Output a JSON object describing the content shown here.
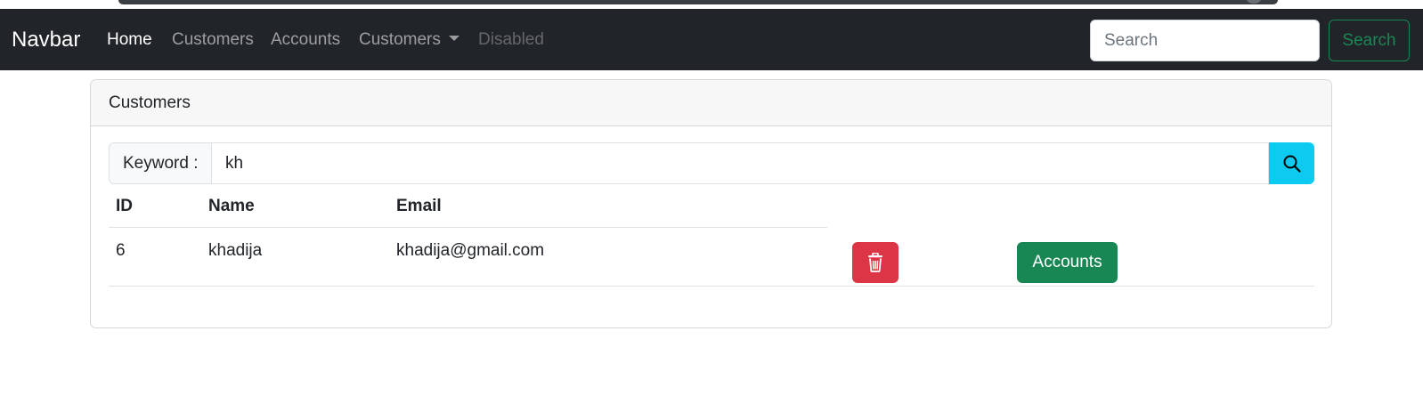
{
  "navbar": {
    "brand": "Navbar",
    "links": [
      {
        "label": "Home",
        "state": "active"
      },
      {
        "label": "Customers",
        "state": "normal"
      },
      {
        "label": "Accounts",
        "state": "normal"
      },
      {
        "label": "Customers",
        "state": "dropdown"
      },
      {
        "label": "Disabled",
        "state": "disabled"
      }
    ],
    "search": {
      "placeholder": "Search",
      "value": ""
    },
    "search_button": "Search"
  },
  "card": {
    "title": "Customers",
    "keyword_label": "Keyword :",
    "keyword_value": "kh",
    "search_icon": "search-icon"
  },
  "table": {
    "columns": [
      "ID",
      "Name",
      "Email"
    ],
    "rows": [
      {
        "id": "6",
        "name": "khadija",
        "email": "khadija@gmail.com",
        "delete_icon": "trash-icon",
        "accounts_label": "Accounts"
      }
    ]
  },
  "colors": {
    "navbar_bg": "#212529",
    "success": "#198754",
    "danger": "#dc3545",
    "info": "#0dcaf0"
  }
}
